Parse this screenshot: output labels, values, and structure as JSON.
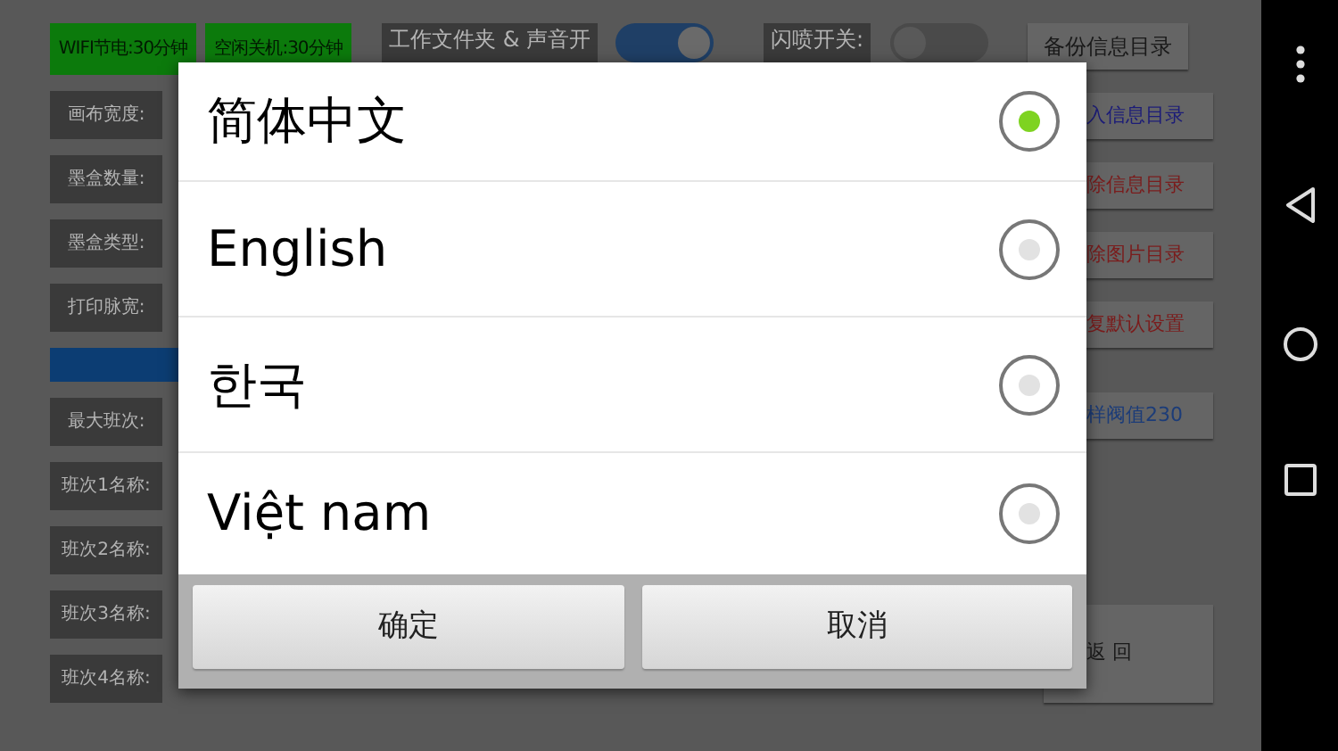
{
  "top_row": [
    {
      "kind": "green",
      "text": "WIFI节电:30分钟"
    },
    {
      "kind": "green",
      "text": "空闲关机:30分钟"
    },
    {
      "kind": "label",
      "text": "工作文件夹 & 声音开"
    },
    {
      "kind": "toggle",
      "on": true
    },
    {
      "kind": "label",
      "text": "闪喷开关:"
    },
    {
      "kind": "toggle",
      "on": false
    },
    {
      "kind": "button",
      "text": "备份信息目录",
      "color": "#1a1a1a"
    }
  ],
  "left_labels": [
    {
      "kind": "label",
      "text": "画布宽度:"
    },
    {
      "kind": "label",
      "text": "墨盒数量:"
    },
    {
      "kind": "label",
      "text": "墨盒类型:"
    },
    {
      "kind": "label",
      "text": "打印脉宽:"
    },
    {
      "kind": "bar"
    },
    {
      "kind": "label",
      "text": "最大班次:"
    },
    {
      "kind": "label",
      "text": "班次1名称:"
    },
    {
      "kind": "label",
      "text": "班次2名称:"
    },
    {
      "kind": "label",
      "text": "班次3名称:"
    },
    {
      "kind": "label",
      "text": "班次4名称:"
    }
  ],
  "right_buttons": [
    {
      "text": "入信息目录",
      "color": "#1c1c78"
    },
    {
      "text": "除信息目录",
      "color": "#7a1c1c"
    },
    {
      "text": "除图片目录",
      "color": "#7a1c1c"
    },
    {
      "text": "复默认设置",
      "color": "#7a1c1c"
    },
    {
      "text": "样阀值230",
      "color": "#1c3c78"
    },
    {
      "text": "返 回",
      "color": "#1a1a1a"
    }
  ],
  "dialog": {
    "options": [
      {
        "label": "简体中文",
        "selected": true
      },
      {
        "label": "English",
        "selected": false
      },
      {
        "label": "한국",
        "selected": false
      },
      {
        "label": "Việt nam",
        "selected": false
      }
    ],
    "buttons": [
      "确定",
      "取消"
    ]
  }
}
